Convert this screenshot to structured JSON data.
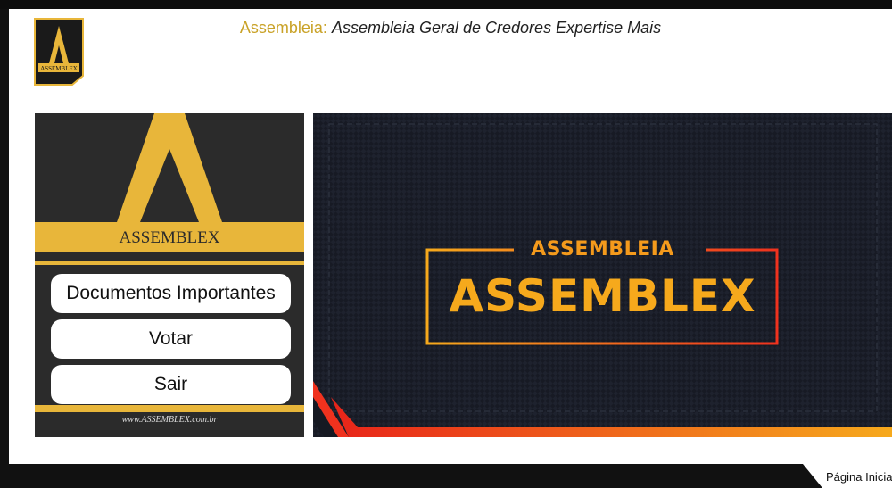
{
  "header": {
    "app_name": "Assembleia:",
    "subtitle": "Assembleia Geral de Credores Expertise Mais",
    "logo_letter": "A",
    "logo_text": "ASSEMBLEX"
  },
  "left_panel": {
    "brand_letter": "A",
    "brand_name": "ASSEMBLEX",
    "buttons": [
      {
        "label": "Documentos Importantes"
      },
      {
        "label": "Votar"
      },
      {
        "label": "Sair"
      }
    ],
    "footer_url": "www.ASSEMBLEX.com.br"
  },
  "banner": {
    "small_text": "ASSEMBLEIA",
    "big_text": "ASSEMBLEX"
  },
  "footer": {
    "home_link": "Página Inicial"
  },
  "colors": {
    "gold": "#e8b63a",
    "orange": "#f6a91c",
    "red": "#f0321e",
    "dark": "#2b2b2b"
  }
}
